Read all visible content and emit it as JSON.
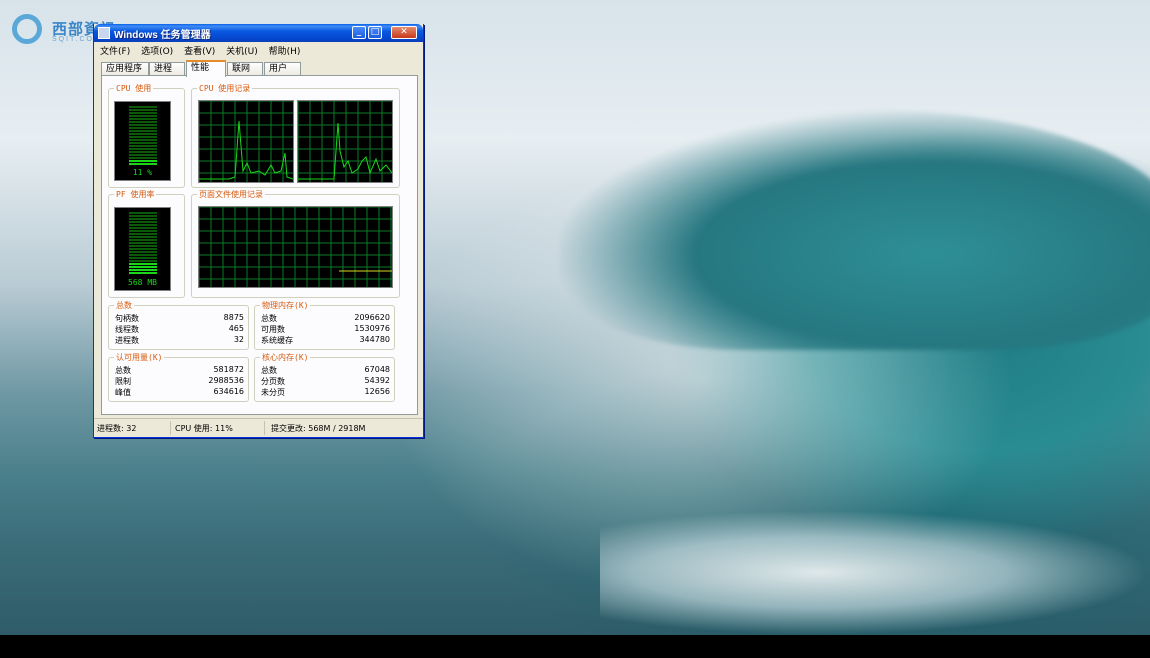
{
  "logo": {
    "text": "西部資訊",
    "sub": "SQIT.COM"
  },
  "window": {
    "title": "Windows 任务管理器"
  },
  "menu": [
    "文件(F)",
    "选项(O)",
    "查看(V)",
    "关机(U)",
    "帮助(H)"
  ],
  "tabs": [
    "应用程序",
    "进程",
    "性能",
    "联网",
    "用户"
  ],
  "active_tab": "性能",
  "cpu": {
    "label": "CPU 使用",
    "value_text": "11 %",
    "percent": 11
  },
  "cpu_history": {
    "label": "CPU 使用记录"
  },
  "pf": {
    "label": "PF 使用率",
    "value_text": "568 MB",
    "fraction": 0.19
  },
  "pf_history": {
    "label": "页面文件使用记录"
  },
  "totals": {
    "label": "总数",
    "rows": [
      {
        "k": "句柄数",
        "v": "8875"
      },
      {
        "k": "线程数",
        "v": "465"
      },
      {
        "k": "进程数",
        "v": "32"
      }
    ]
  },
  "physical": {
    "label": "物理内存(K)",
    "rows": [
      {
        "k": "总数",
        "v": "2096620"
      },
      {
        "k": "可用数",
        "v": "1530976"
      },
      {
        "k": "系统缓存",
        "v": "344780"
      }
    ]
  },
  "commit": {
    "label": "认可用量(K)",
    "rows": [
      {
        "k": "总数",
        "v": "581872"
      },
      {
        "k": "限制",
        "v": "2988536"
      },
      {
        "k": "峰值",
        "v": "634616"
      }
    ]
  },
  "kernel": {
    "label": "核心内存(K)",
    "rows": [
      {
        "k": "总数",
        "v": "67048"
      },
      {
        "k": "分页数",
        "v": "54392"
      },
      {
        "k": "未分页",
        "v": "12656"
      }
    ]
  },
  "status": {
    "processes": "进程数: 32",
    "cpu": "CPU 使用: 11%",
    "commit": "提交更改: 568M / 2918M"
  },
  "colors": {
    "meter_green": "#19d819",
    "grid": "#0a7a28",
    "pf_line": "#d8d820"
  }
}
